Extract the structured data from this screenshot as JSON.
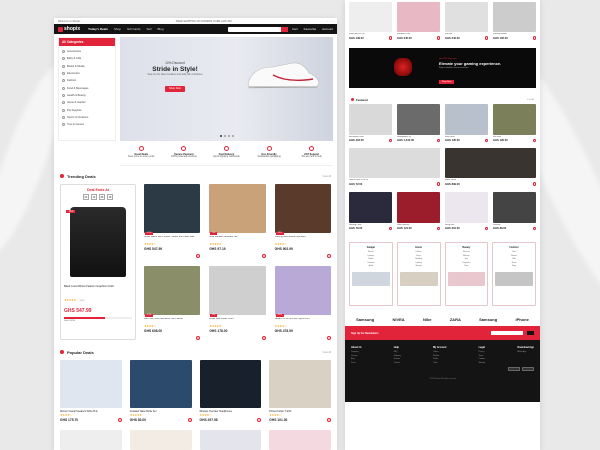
{
  "header": {
    "promo_left": "Welcome to Shopix",
    "promo_right": "FREE SHIPPING ON ORDERS OVER GHS 200",
    "logo": "shopix",
    "nav": [
      "Today's Deals",
      "Shop",
      "Gift Cards",
      "Sell",
      "Blog"
    ],
    "search_placeholder": "Search...",
    "icons": [
      "Cart",
      "Favourite",
      "Account"
    ]
  },
  "categories": {
    "title": "All Categories",
    "items": [
      "Accessories",
      "Baby & Kids",
      "Books & Media",
      "Electronics",
      "Fashion",
      "Food & Beverages",
      "Health & Beauty",
      "Home & Garden",
      "Pet Supplies",
      "Sports & Outdoors",
      "Toys & Games"
    ]
  },
  "hero": {
    "offer": "10% Discount",
    "title": "Stride in Style!",
    "subtitle": "Step into the latest sneakers and walk with confidence",
    "button": "Shop Now"
  },
  "features": [
    {
      "title": "Great Deals",
      "text": "Save more on every order"
    },
    {
      "title": "Secure Payment",
      "text": "100% protected checkout"
    },
    {
      "title": "Fast Delivery",
      "text": "Quick shipping nationwide"
    },
    {
      "title": "Eco-Friendly",
      "text": "Sustainable packaging"
    },
    {
      "title": "24/7 Support",
      "text": "We are here to help"
    }
  ],
  "trending": {
    "title": "Trending Deals",
    "view_all": "View All",
    "deal_day": {
      "title": "Deal Ends At",
      "timer": [
        "04",
        "12",
        "36",
        "18"
      ],
      "badge": "-15%",
      "name": "Black Lined Winter Fashion Graphics Outfit",
      "rating": "★★★★★",
      "reviews": "(50)",
      "price": "GHS 547.99",
      "sold": "Sold: 30/50",
      "sold_fraction": 0.6
    },
    "products": [
      {
        "name": "Smart Watch with Fitness Tracker and Heart Rate",
        "rating": "★★★★☆",
        "price": "GHS 547.99",
        "tag": "-10%",
        "color": "#2b3a44"
      },
      {
        "name": "Gold Pendant Necklace Set",
        "rating": "★★★★★",
        "price": "GHS 97.19",
        "tag": "-5%",
        "color": "#c9a27a"
      },
      {
        "name": "Gaming Mechanical Keyboard",
        "rating": "★★★★☆",
        "price": "GHS 902.99",
        "tag": "-20%",
        "color": "#5a3a2a"
      },
      {
        "name": "Men Two Tone Patchwork Shirt Jacket",
        "rating": "★★★★☆",
        "price": "GHS 608.00",
        "tag": "-12%",
        "color": "#8a8f6a"
      },
      {
        "name": "Lolita Style Dress Outfit",
        "rating": "★★★★★",
        "price": "GHS 178.00",
        "tag": "-8%",
        "color": "#cfcfcf"
      },
      {
        "name": "Tablet Pro 11 Inch with Stylus Pen",
        "rating": "★★★★☆",
        "price": "GHS 478.99",
        "tag": "-15%",
        "color": "#b9a9d6"
      }
    ]
  },
  "popular": {
    "title": "Popular Deals",
    "view_all": "View All",
    "products": [
      {
        "name": "Women Casual Sneakers White Pink",
        "rating": "★★★★☆",
        "price": "GHS 175.70",
        "color": "#dfe6ef"
      },
      {
        "name": "Insulated Water Bottle Set",
        "rating": "★★★★★",
        "price": "GHS 80.00",
        "color": "#2c4a6b"
      },
      {
        "name": "Wireless Over-Ear Headphones",
        "rating": "★★★★☆",
        "price": "GHS 297.98",
        "color": "#18202c"
      },
      {
        "name": "Printed Cotton T-Shirt",
        "rating": "★★★★☆",
        "price": "GHS 101.30",
        "color": "#d9d2c4"
      }
    ]
  },
  "right": {
    "top_row": [
      {
        "price": "GHS 139.20",
        "name": "Kids Ride On Car",
        "color": "#eeeeee"
      },
      {
        "price": "GHS 340.00",
        "name": "Backpack Pink",
        "color": "#e8b9c4"
      },
      {
        "price": "GHS 240.00",
        "name": "Sun Hat",
        "color": "#e0e0e0"
      },
      {
        "price": "GHS 165.00",
        "name": "Running Shoes",
        "color": "#cccccc"
      }
    ],
    "gaming_banner": {
      "offer": "Get 20% Discount",
      "title": "Elevate your gaming experience.",
      "text": "Shop controllers and accessories",
      "button": "Shop Now"
    },
    "featured_title": "Featured",
    "featured_view_all": "View All",
    "featured_rows": [
      [
        {
          "price": "GHS 464.05",
          "name": "Microwave Oven",
          "color": "#d9d9d9"
        },
        {
          "price": "GHS 1,344.00",
          "name": "Smartphone 5G",
          "color": "#6b6b6b"
        },
        {
          "price": "GHS 135.00",
          "name": "Kids Dress",
          "color": "#b8c0cc"
        },
        {
          "price": "GHS 195.00",
          "name": "Knit Vest",
          "color": "#7b7f5a"
        }
      ],
      [
        {
          "price": "GHS 72.00",
          "name": "Limited Offer 30% Off",
          "color": "#dcdcdc"
        },
        {
          "price": "GHS 899.00",
          "name": "Home Decor",
          "color": "#3a3430"
        }
      ],
      [
        {
          "price": "GHS 79.00",
          "name": "Gaming Chair",
          "color": "#2a2a3c"
        },
        {
          "price": "GHS 121.00",
          "name": "Wine Glasses",
          "color": "#9b1c2a"
        },
        {
          "price": "GHS 210.00",
          "name": "Vanity Set",
          "color": "#ece6ef"
        },
        {
          "price": "GHS 88.00",
          "name": "Perfume",
          "color": "#444"
        }
      ]
    ],
    "cat_boxes": [
      {
        "title": "Gadget",
        "items": [
          "Phones",
          "Laptops",
          "Tablets",
          "Cameras",
          "Audio"
        ],
        "color": "#cfd6de"
      },
      {
        "title": "Home",
        "items": [
          "Kitchen",
          "Decor",
          "Bedding",
          "Lighting",
          "Storage"
        ],
        "color": "#d8cfc3"
      },
      {
        "title": "Beauty",
        "items": [
          "Skincare",
          "Makeup",
          "Hair",
          "Fragrance",
          "Tools"
        ],
        "color": "#e9c7cf"
      },
      {
        "title": "Fashion",
        "items": [
          "Men",
          "Women",
          "Kids",
          "Shoes",
          "Bags"
        ],
        "color": "#c5c5c5"
      }
    ],
    "brands": [
      "Samsung",
      "NIVEA",
      "Nike",
      "ZARA",
      "Samsung",
      "iPhone"
    ],
    "footer": {
      "newsletter": "Sign Up For Newsletters",
      "subscribe": "Subscribe",
      "columns": [
        {
          "heading": "About Us",
          "links": [
            "Company",
            "Careers",
            "Blog",
            "Press"
          ]
        },
        {
          "heading": "Help",
          "links": [
            "FAQ",
            "Shipping",
            "Returns",
            "Contact"
          ]
        },
        {
          "heading": "My Account",
          "links": [
            "Orders",
            "Wishlist",
            "Profile",
            "Track"
          ]
        },
        {
          "heading": "Legal",
          "links": [
            "Privacy",
            "Terms",
            "Cookies",
            "Sitemap"
          ]
        },
        {
          "heading": "Download App",
          "links": [
            "Mobile App"
          ]
        }
      ],
      "copyright": "© 2024 Shopix. All rights reserved."
    }
  },
  "colors": {
    "accent": "#e1243a",
    "dark": "#141414"
  }
}
